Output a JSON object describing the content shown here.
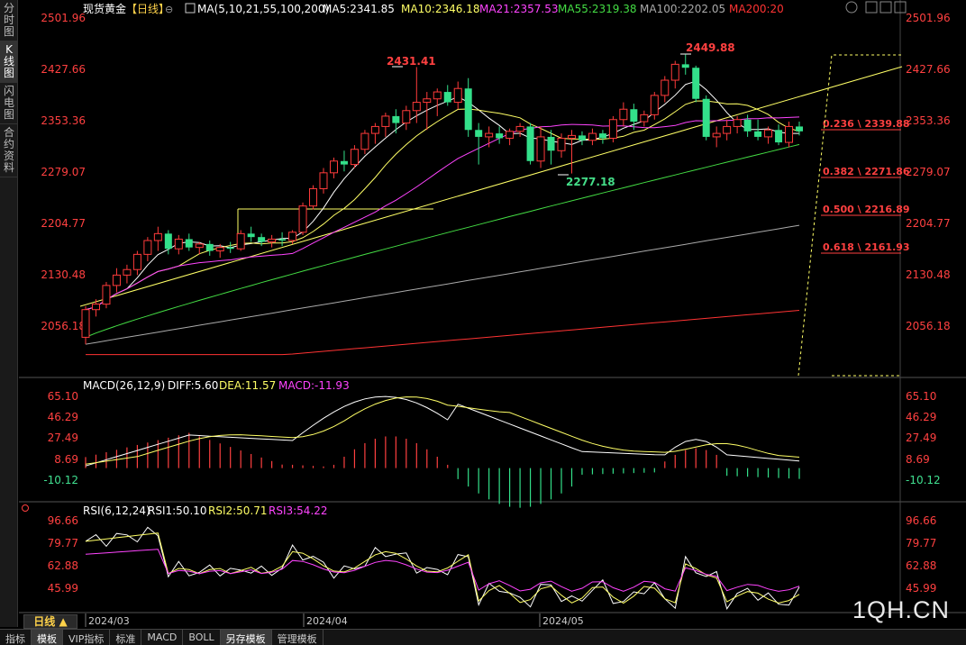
{
  "sidebar": {
    "tabs": [
      {
        "label": "分时图",
        "chars": [
          "分",
          "时",
          "图"
        ],
        "active": false
      },
      {
        "label": "K线图",
        "chars": [
          "K",
          "线",
          "图"
        ],
        "active": true
      },
      {
        "label": "闪电图",
        "chars": [
          "闪",
          "电",
          "图"
        ],
        "active": false
      },
      {
        "label": "合约资料",
        "chars": [
          "合",
          "约",
          "资",
          "料"
        ],
        "active": false
      }
    ]
  },
  "header": {
    "instrument": "现货黄金",
    "period_tag": "【日线】",
    "ma_params": "MA(5,10,21,55,100,200)",
    "ma_values": [
      {
        "label": "MA5:2341.85",
        "color": "#ffffff"
      },
      {
        "label": "MA10:2346.18",
        "color": "#ffff66"
      },
      {
        "label": "MA21:2357.53",
        "color": "#ff44ff"
      },
      {
        "label": "MA55:2319.38",
        "color": "#44dd44"
      },
      {
        "label": "MA100:2202.05",
        "color": "#aaaaaa"
      },
      {
        "label": "MA200:20",
        "color": "#ff3333"
      }
    ]
  },
  "main_axis_labels": [
    "2501.96",
    "2427.66",
    "2353.36",
    "2279.07",
    "2204.77",
    "2130.48",
    "2056.18"
  ],
  "annotations": {
    "high1": "2431.41",
    "high2": "2449.88",
    "low1": "2277.18"
  },
  "fib_levels": [
    {
      "label": "0.236 \\ 2339.88",
      "value": 2339.88
    },
    {
      "label": "0.382 \\ 2271.86",
      "value": 2271.86
    },
    {
      "label": "0.500 \\ 2216.89",
      "value": 2216.89
    },
    {
      "label": "0.618 \\ 2161.93",
      "value": 2161.93
    }
  ],
  "macd": {
    "title": "MACD(26,12,9)",
    "diff": "DIFF:5.60",
    "dea": "DEA:11.57",
    "macd": "MACD:-11.93",
    "axis_labels": [
      "65.10",
      "46.29",
      "27.49",
      "8.69",
      "-10.12"
    ]
  },
  "rsi": {
    "title": "RSI(6,12,24)",
    "rsi1": "RSI1:50.10",
    "rsi2": "RSI2:50.71",
    "rsi3": "RSI3:54.22",
    "axis_labels": [
      "96.66",
      "79.77",
      "62.88",
      "45.99"
    ]
  },
  "x_axis_labels": [
    "2024/03",
    "2024/04",
    "2024/05"
  ],
  "period_button": "日线 ▲",
  "bottom_tabs": [
    {
      "label": "指标",
      "active": false
    },
    {
      "label": "模板",
      "active": true
    },
    {
      "label": "VIP指标",
      "active": false
    },
    {
      "label": "标准",
      "active": false
    },
    {
      "label": "MACD",
      "active": false
    },
    {
      "label": "BOLL",
      "active": false
    },
    {
      "label": "另存模板",
      "active": true
    },
    {
      "label": "管理模板",
      "active": false
    }
  ],
  "watermark": "1QH.CN",
  "colors": {
    "up": "#ff3b3b",
    "down": "#33e08a",
    "ma5": "#ffffff",
    "ma10": "#ffff66",
    "ma21": "#ff44ff",
    "ma55": "#44dd44",
    "ma100": "#aaaaaa",
    "ma200": "#ff3333",
    "axis_red": "#ff4040",
    "trend": "#ffff66"
  },
  "candles": [
    [
      2040,
      2085,
      2030,
      2080
    ],
    [
      2080,
      2095,
      2070,
      2088
    ],
    [
      2088,
      2120,
      2082,
      2115
    ],
    [
      2115,
      2140,
      2105,
      2130
    ],
    [
      2130,
      2145,
      2118,
      2138
    ],
    [
      2138,
      2165,
      2130,
      2160
    ],
    [
      2160,
      2185,
      2150,
      2180
    ],
    [
      2180,
      2200,
      2165,
      2190
    ],
    [
      2190,
      2195,
      2160,
      2168
    ],
    [
      2168,
      2188,
      2160,
      2182
    ],
    [
      2182,
      2190,
      2165,
      2170
    ],
    [
      2170,
      2178,
      2160,
      2175
    ],
    [
      2175,
      2180,
      2158,
      2165
    ],
    [
      2165,
      2175,
      2155,
      2170
    ],
    [
      2170,
      2178,
      2162,
      2168
    ],
    [
      2168,
      2195,
      2165,
      2190
    ],
    [
      2190,
      2200,
      2178,
      2185
    ],
    [
      2185,
      2190,
      2172,
      2178
    ],
    [
      2178,
      2188,
      2170,
      2182
    ],
    [
      2182,
      2192,
      2172,
      2180
    ],
    [
      2180,
      2195,
      2175,
      2192
    ],
    [
      2192,
      2235,
      2188,
      2230
    ],
    [
      2230,
      2260,
      2225,
      2255
    ],
    [
      2255,
      2285,
      2248,
      2278
    ],
    [
      2278,
      2300,
      2270,
      2295
    ],
    [
      2295,
      2310,
      2280,
      2290
    ],
    [
      2290,
      2318,
      2285,
      2312
    ],
    [
      2312,
      2340,
      2305,
      2335
    ],
    [
      2335,
      2350,
      2320,
      2345
    ],
    [
      2345,
      2365,
      2330,
      2360
    ],
    [
      2360,
      2370,
      2335,
      2350
    ],
    [
      2350,
      2375,
      2340,
      2368
    ],
    [
      2368,
      2431,
      2350,
      2380
    ],
    [
      2380,
      2395,
      2340,
      2385
    ],
    [
      2385,
      2400,
      2360,
      2395
    ],
    [
      2395,
      2405,
      2375,
      2380
    ],
    [
      2380,
      2410,
      2370,
      2400
    ],
    [
      2400,
      2415,
      2330,
      2340
    ],
    [
      2340,
      2350,
      2290,
      2330
    ],
    [
      2330,
      2345,
      2315,
      2335
    ],
    [
      2335,
      2345,
      2320,
      2328
    ],
    [
      2328,
      2342,
      2318,
      2338
    ],
    [
      2338,
      2350,
      2330,
      2345
    ],
    [
      2345,
      2350,
      2290,
      2295
    ],
    [
      2295,
      2345,
      2285,
      2330
    ],
    [
      2330,
      2340,
      2290,
      2310
    ],
    [
      2310,
      2335,
      2300,
      2328
    ],
    [
      2328,
      2340,
      2277,
      2332
    ],
    [
      2332,
      2338,
      2318,
      2325
    ],
    [
      2325,
      2342,
      2318,
      2335
    ],
    [
      2335,
      2340,
      2320,
      2328
    ],
    [
      2328,
      2360,
      2322,
      2355
    ],
    [
      2355,
      2380,
      2345,
      2370
    ],
    [
      2370,
      2378,
      2340,
      2352
    ],
    [
      2352,
      2368,
      2345,
      2362
    ],
    [
      2362,
      2395,
      2355,
      2390
    ],
    [
      2390,
      2418,
      2380,
      2412
    ],
    [
      2412,
      2440,
      2400,
      2435
    ],
    [
      2435,
      2449,
      2420,
      2430
    ],
    [
      2430,
      2433,
      2380,
      2385
    ],
    [
      2385,
      2390,
      2325,
      2330
    ],
    [
      2330,
      2345,
      2315,
      2335
    ],
    [
      2335,
      2355,
      2325,
      2345
    ],
    [
      2345,
      2360,
      2335,
      2355
    ],
    [
      2355,
      2362,
      2330,
      2338
    ],
    [
      2338,
      2355,
      2325,
      2330
    ],
    [
      2330,
      2345,
      2320,
      2340
    ],
    [
      2340,
      2348,
      2318,
      2322
    ],
    [
      2322,
      2352,
      2315,
      2345
    ],
    [
      2345,
      2352,
      2332,
      2338
    ]
  ]
}
